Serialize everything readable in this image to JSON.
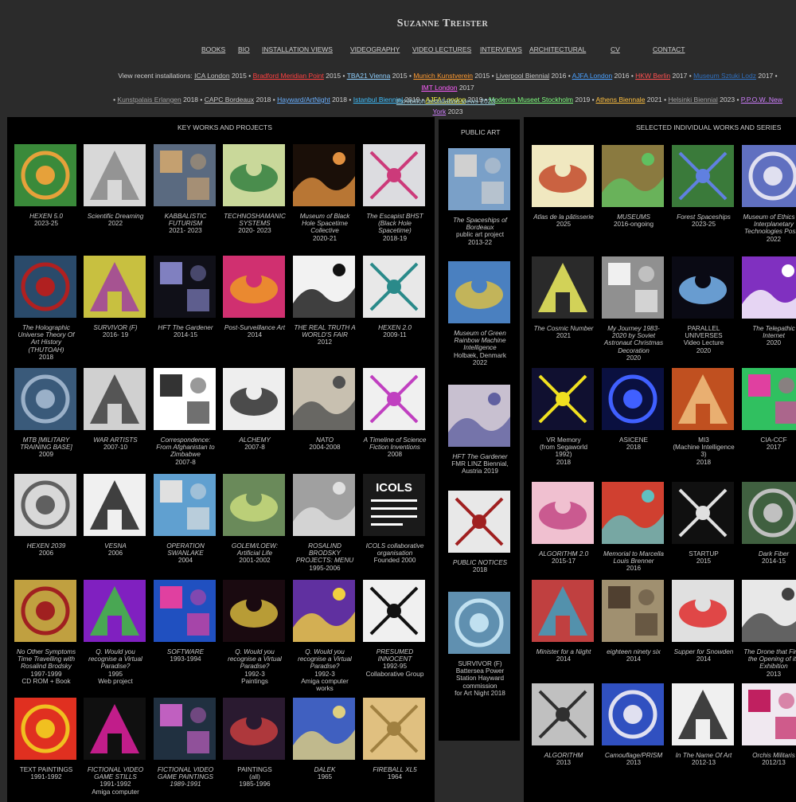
{
  "site": {
    "title": "Suzanne Treister"
  },
  "nav": [
    {
      "label": "BOOKS"
    },
    {
      "label": "BIO"
    },
    {
      "label": "INSTALLATION VIEWS"
    },
    {
      "label": "VIDEOGRAPHY"
    },
    {
      "label": "VIDEO LECTURES"
    },
    {
      "label": "INTERVIEWS"
    },
    {
      "label": "ARCHITECTURAL"
    },
    {
      "label": "CV"
    },
    {
      "label": "CONTACT"
    }
  ],
  "installations": {
    "lead": "View recent installations:",
    "items": [
      {
        "label": "ICA London",
        "year": "2015",
        "color": "#c8c8c8"
      },
      {
        "label": "Bradford Meridian Point",
        "year": "2015",
        "color": "#ff4040"
      },
      {
        "label": "TBA21 Vienna",
        "year": "2015",
        "color": "#8fd0ff"
      },
      {
        "label": "Munich Kunstverein",
        "year": "2015",
        "color": "#ff9a30"
      },
      {
        "label": "Liverpool Biennial",
        "year": "2016",
        "color": "#c8c8c8"
      },
      {
        "label": "AJFA London",
        "year": "2016",
        "color": "#4aa0ff"
      },
      {
        "label": "HKW Berlin",
        "year": "2017",
        "color": "#ff5050"
      },
      {
        "label": "Museum Sztuki Lodz",
        "year": "2017",
        "color": "#3070c0"
      },
      {
        "label": "IMT London",
        "year": "2017",
        "color": "#ff60ff"
      },
      {
        "label": "Kunstpalais Erlangen",
        "year": "2018",
        "color": "#a0a0a0"
      },
      {
        "label": "CAPC Bordeaux",
        "year": "2018",
        "color": "#c8c8c8"
      },
      {
        "label": "Hayward/ArtNight",
        "year": "2018",
        "color": "#6ab0ff"
      },
      {
        "label": "Istanbul Biennial",
        "year": "2019",
        "color": "#40c0ff"
      },
      {
        "label": "AJFA London",
        "year": "2019",
        "color": "#ffff40"
      },
      {
        "label": "Moderna Museet Stockholm",
        "year": "2019",
        "color": "#80ff80"
      },
      {
        "label": "Athens Biennale",
        "year": "2021",
        "color": "#ffc040"
      },
      {
        "label": "Helsinki Biennial",
        "year": "2023",
        "color": "#a0a0a0"
      },
      {
        "label": "P.P.O.W. New York",
        "year": "2023",
        "color": "#d080ff"
      }
    ]
  },
  "exhibition_link": "Exhibition installation views 2023",
  "sections": {
    "key_works": {
      "title": "KEY WORKS AND PROJECTS",
      "rows": [
        [
          {
            "title": "HEXEN 5.0",
            "date": "2023-25",
            "thumb": "#3a8a3a",
            "accent": "#e6a13a"
          },
          {
            "title": "Scientific Dreaming",
            "date": "2022",
            "thumb": "#d8d8d8",
            "accent": "#888888"
          },
          {
            "title": "KABBALISTIC FUTURISM",
            "date": "2021- 2023",
            "thumb": "#5a6a80",
            "accent": "#c4a070"
          },
          {
            "title": "TECHNOSHAMANIC SYSTEMS",
            "date": "2020- 2023",
            "thumb": "#c9d89a",
            "accent": "#2a7a3a"
          },
          {
            "title": "Museum of Black Hole Spacetime Collective",
            "date": "2020-21",
            "thumb": "#1a0f08",
            "accent": "#e09040"
          },
          {
            "title": "The Escapist BHST (Black Hole Spacetime)",
            "date": "2018-19",
            "thumb": "#dcdce0",
            "accent": "#cc3a7a"
          }
        ],
        [
          {
            "title": "The Holographic Universe Theory Of Art History (THUTOAH)",
            "date": "2018",
            "thumb": "#2a4a6a",
            "accent": "#b02020"
          },
          {
            "title": "SURVIVOR (F)",
            "date": "2016- 19",
            "thumb": "#c8c040",
            "accent": "#a040a0"
          },
          {
            "title": "HFT The Gardener",
            "date": "2014-15",
            "thumb": "#101018",
            "accent": "#8080c0"
          },
          {
            "title": "Post-Surveillance Art",
            "date": "2014",
            "thumb": "#d03070",
            "accent": "#f0a020"
          },
          {
            "title": "THE REAL TRUTH A WORLD'S FAIR",
            "date": "2012",
            "thumb": "#f2f2f2",
            "accent": "#111111"
          },
          {
            "title": "HEXEN 2.0",
            "date": "2009-11",
            "thumb": "#e8e8e8",
            "accent": "#2a8a8a"
          }
        ],
        [
          {
            "title": "MTB [MILITARY TRAINING BASE]",
            "date": "2009",
            "thumb": "#3a5a7a",
            "accent": "#9ab0c8"
          },
          {
            "title": "WAR ARTISTS",
            "date": "2007-10",
            "thumb": "#d0d0d0",
            "accent": "#404040"
          },
          {
            "title": "Correspondence: From Afghanistan to Zimbabwe",
            "date": "2007-8",
            "thumb": "#ffffff",
            "accent": "#333333"
          },
          {
            "title": "ALCHEMY",
            "date": "2007-8",
            "thumb": "#eeeeee",
            "accent": "#222222"
          },
          {
            "title": "NATO",
            "date": "2004-2008",
            "thumb": "#c8c0b0",
            "accent": "#505050"
          },
          {
            "title": "A Timeline of Science Fiction Inventions",
            "date": "2008",
            "thumb": "#f0f0f0",
            "accent": "#c040c0"
          }
        ],
        [
          {
            "title": "HEXEN 2039",
            "date": "2006",
            "thumb": "#d8d8d8",
            "accent": "#606060"
          },
          {
            "title": "VESNA",
            "date": "2006",
            "thumb": "#f0f0f0",
            "accent": "#202020"
          },
          {
            "title": "OPERATION SWANLAKE",
            "date": "2004",
            "thumb": "#60a0d0",
            "accent": "#e0e0e0"
          },
          {
            "title": "GOLEM/LOEW: Artificial Life",
            "date": "2001-2002",
            "thumb": "#6a8a5a",
            "accent": "#d0e080"
          },
          {
            "title": "ROSALIND BRODSKY PROJECTS: MENU",
            "date": "1995-2006",
            "thumb": "#a0a0a0",
            "accent": "#e0e0e0"
          },
          {
            "title": "ICOLS collaborative organisation",
            "date": "Founded 2000",
            "thumb": "#1a1a1a",
            "accent": "#ffffff",
            "label": "ICOLS"
          }
        ],
        [
          {
            "title": "No Other Symptoms Time Travelling with Rosalind Brodsky",
            "date": "1997-1999",
            "extra": "CD ROM + Book",
            "thumb": "#c0a040",
            "accent": "#a02020"
          },
          {
            "title": "Q. Would you recognise a Virtual Paradise?",
            "date": "1995",
            "extra": "Web project",
            "thumb": "#8020c0",
            "accent": "#40c040"
          },
          {
            "title": "SOFTWARE",
            "date": "1993-1994",
            "thumb": "#2050c0",
            "accent": "#e040a0"
          },
          {
            "title": "Q. Would you recognise a Virtual Paradise?",
            "date": "1992-3",
            "extra": "Paintings",
            "thumb": "#1a0a10",
            "accent": "#e0c040"
          },
          {
            "title": "Q. Would you recognise a Virtual Paradise?",
            "date": "1992-3",
            "extra": "Amiga computer works",
            "thumb": "#6030a0",
            "accent": "#f0d040"
          },
          {
            "title": "PRESUMED INNOCENT",
            "date": "1992-95",
            "extra": "Collaborative Group",
            "thumb": "#f0f0f0",
            "accent": "#111111"
          }
        ],
        [
          {
            "title": "TEXT PAINTINGS",
            "date": "1991-1992",
            "thumb": "#e03020",
            "accent": "#f0c020",
            "plain": true
          },
          {
            "title": "FICTIONAL VIDEO GAME STILLS",
            "date": "1991-1992",
            "extra": "Amiga computer",
            "thumb": "#101010",
            "accent": "#e020a0"
          },
          {
            "title": "FICTIONAL VIDEO GAME PAINTINGS",
            "date": "1989-1991",
            "thumb": "#203040",
            "accent": "#c060c0",
            "italDate": true
          },
          {
            "title": "PAINTINGS",
            "date": "(all)",
            "extra": "1985-1996",
            "thumb": "#2a1a30",
            "accent": "#d04040",
            "plain": true
          },
          {
            "title": "DALEK",
            "date": "1965",
            "thumb": "#4060c0",
            "accent": "#e0d080"
          },
          {
            "title": "FIREBALL XL5",
            "date": "1964",
            "thumb": "#e0c080",
            "accent": "#a08040"
          }
        ]
      ]
    },
    "public_art": {
      "title": "PUBLIC ART",
      "items": [
        {
          "title": "The Spaceships of Bordeaux",
          "date": "public art project",
          "extra": "2013-22",
          "thumb": "#7aa0c8",
          "accent": "#d0d0d0"
        },
        {
          "title": "Museum of Green Rainbow Machine Intelligence",
          "date": "Holbæk, Denmark",
          "extra": "2022",
          "thumb": "#4a80c0",
          "accent": "#e0c040"
        },
        {
          "title": "HFT The Gardener",
          "date": "FMR LINZ Biennial, Austria 2019",
          "thumb": "#c8c0d0",
          "accent": "#6060a0",
          "plainTitle": false
        },
        {
          "title": "PUBLIC NOTICES",
          "date": "2018",
          "thumb": "#e8e8e8",
          "accent": "#a02020",
          "caps": true
        },
        {
          "title": "SURVIVOR (F)",
          "date": "Battersea Power Station Hayward commission",
          "extra": "for Art Night 2018",
          "thumb": "#6090b0",
          "accent": "#c0e0f0",
          "plainTitle": true
        }
      ]
    },
    "selected": {
      "title": "SELECTED INDIVIDUAL WORKS AND SERIES",
      "rows": [
        [
          {
            "title": "Atlas de la pâtisserie",
            "date": "2025",
            "thumb": "#f0e8c0",
            "accent": "#c04020"
          },
          {
            "title": "MUSEUMS",
            "date": "2016-ongoing",
            "thumb": "#8a7a40",
            "accent": "#60c060"
          },
          {
            "title": "Forest Spaceships",
            "date": "2023-25",
            "thumb": "#3a7a3a",
            "accent": "#6080e0"
          },
          {
            "title": "Museum of Ethics for Interplanetary Technologies Poster",
            "date": "2022",
            "thumb": "#6070c0",
            "accent": "#e0e0f0"
          }
        ],
        [
          {
            "title": "The Cosmic Number",
            "date": "2021",
            "thumb": "#2a2a2a",
            "accent": "#f0f060"
          },
          {
            "title": "My Journey 1983-2020 by Soviet Astronaut Christmas Decoration",
            "date": "2020",
            "thumb": "#909090",
            "accent": "#f0f0f0"
          },
          {
            "title": "PARALLEL UNIVERSES",
            "date": "Video Lecture",
            "extra": "2020",
            "thumb": "#0a0a14",
            "accent": "#80c0ff",
            "plain": true
          },
          {
            "title": "The Telepathic Internet",
            "date": "2020",
            "thumb": "#8030c0",
            "accent": "#ffffff"
          }
        ],
        [
          {
            "title": "VR Memory",
            "date": "(from Segaworld 1992)",
            "extra": "2018",
            "thumb": "#101030",
            "accent": "#f0e020",
            "plain": true
          },
          {
            "title": "ASICENE",
            "date": "2018",
            "thumb": "#0a1040",
            "accent": "#4060ff",
            "plain": true
          },
          {
            "title": "MI3",
            "date": "(Machine Intelligence 3)",
            "extra": "2018",
            "thumb": "#c05020",
            "accent": "#f0c080",
            "plain": true
          },
          {
            "title": "CIA-CCF",
            "date": "2017",
            "thumb": "#30c060",
            "accent": "#e040a0",
            "plain": true
          }
        ],
        [
          {
            "title": "ALGORITHM 2.0",
            "date": "2015-17",
            "thumb": "#f0c0d0",
            "accent": "#c04080"
          },
          {
            "title": "Memorial to Marcella Louis Brenner",
            "date": "2016",
            "thumb": "#d04030",
            "accent": "#60c0c0"
          },
          {
            "title": "STARTUP",
            "date": "2015",
            "thumb": "#101010",
            "accent": "#e0e0e0",
            "plain": true
          },
          {
            "title": "Dark Fiber",
            "date": "2014-15",
            "thumb": "#406040",
            "accent": "#c0c0c0"
          }
        ],
        [
          {
            "title": "Minister for a Night",
            "date": "2014",
            "thumb": "#c04040",
            "accent": "#40a0c0"
          },
          {
            "title": "eighteen ninety six",
            "date": "2014",
            "thumb": "#a09070",
            "accent": "#504030"
          },
          {
            "title": "Supper for Snowden",
            "date": "2014",
            "thumb": "#e0e0e0",
            "accent": "#e02020"
          },
          {
            "title": "The Drone that Fired the Opening of its Exhibition",
            "date": "2013",
            "thumb": "#e8e8e8",
            "accent": "#404040"
          }
        ],
        [
          {
            "title": "ALGORITHM",
            "date": "2013",
            "thumb": "#c0c0c0",
            "accent": "#303030"
          },
          {
            "title": "Camouflage/PRISM",
            "date": "2013",
            "thumb": "#3050c0",
            "accent": "#e0e0f0"
          },
          {
            "title": "In The Name Of Art",
            "date": "2012-13",
            "thumb": "#f0f0f0",
            "accent": "#202020"
          },
          {
            "title": "Orchis Militaris",
            "date": "2012/13",
            "thumb": "#f0e8f0",
            "accent": "#c02060"
          }
        ]
      ]
    }
  }
}
